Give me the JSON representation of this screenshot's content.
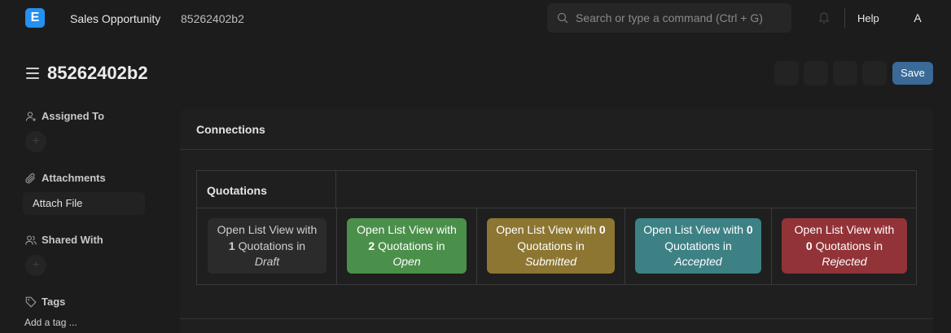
{
  "navbar": {
    "logo_letter": "E",
    "breadcrumbs": [
      "Sales Opportunity",
      "85262402b2"
    ],
    "search_placeholder": "Search or type a command (Ctrl + G)",
    "help_label": "Help",
    "avatar_initial": "A"
  },
  "page": {
    "title": "85262402b2",
    "save_label": "Save"
  },
  "sidebar": {
    "assigned_to": "Assigned To",
    "attachments": "Attachments",
    "attach_file": "Attach File",
    "shared_with": "Shared With",
    "tags": "Tags",
    "add_tag": "Add a tag ..."
  },
  "connections": {
    "heading": "Connections",
    "group_title": "Quotations",
    "cards": [
      {
        "prefix": "Open List View with",
        "count": "1",
        "middle": "Quotations in",
        "status": "Draft",
        "color": "#2b2b2b"
      },
      {
        "prefix": "Open List View with",
        "count": "2",
        "middle": "Quotations in",
        "status": "Open",
        "color": "#4a8f4a"
      },
      {
        "prefix": "Open List View with",
        "count": "0",
        "middle": "Quotations in",
        "status": "Submitted",
        "color": "#8d7632"
      },
      {
        "prefix": "Open List View with",
        "count": "0",
        "middle": "Quotations in",
        "status": "Accepted",
        "color": "#3d8185"
      },
      {
        "prefix": "Open List View with",
        "count": "0",
        "middle": "Quotations in",
        "status": "Rejected",
        "color": "#923338"
      }
    ]
  },
  "icons": {
    "logo": "erpnext-logo-icon",
    "search": "search-icon",
    "notifications": "bell-icon",
    "menu": "hamburger-icon",
    "assigned": "user-plus-icon",
    "attachments": "paperclip-icon",
    "shared": "users-icon",
    "tags": "tag-icon"
  },
  "colors": {
    "accent": "#2490ef",
    "save_button": "#3a6a97",
    "background": "#1c1c1c"
  }
}
